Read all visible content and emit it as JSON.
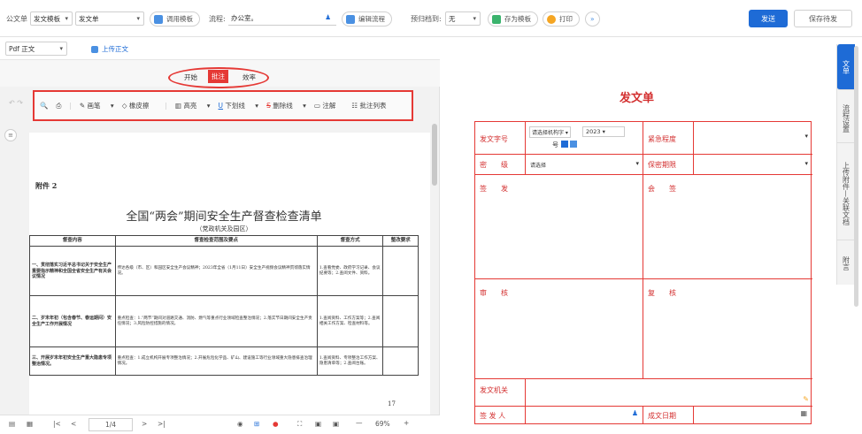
{
  "topbar": {
    "type_label": "公文单",
    "template_value": "发文模板",
    "form_value": "发文单",
    "call_template": "调用模板",
    "flow_label": "流程:",
    "flow_value": "办公室。",
    "edit_flow": "编辑流程",
    "archive_label": "预归档到:",
    "archive_value": "无",
    "save_as_template": "存为模板",
    "print": "打印",
    "send": "发送",
    "save_pending": "保存待发"
  },
  "subbar": {
    "format_value": "Pdf 正文",
    "upload": "上传正文"
  },
  "modes": {
    "start": "开始",
    "annotate": "批注",
    "effect": "效率"
  },
  "toolbar": {
    "brush": "画笔",
    "eraser": "橡皮擦",
    "highlight": "高亮",
    "underline": "下划线",
    "strikethrough": "删除线",
    "note": "注解",
    "list": "批注列表"
  },
  "doc": {
    "attachment": "附件 2",
    "title": "全国“两会”期间安全生产督查检查清单",
    "subtitle": "（党政机关及园区）",
    "headers": [
      "督查内容",
      "督查检查范围及要点",
      "督查方式",
      "整改要求"
    ],
    "rows": [
      {
        "c1": "一、贯彻落实习近平总书记关于安全生产重要指示精神和全国全省安全生产有关会议情况",
        "c2": "传达各级（市、区）和园区安全生产会议精神；2023年全省（1月11日）安全生产视频会议精神贯彻落实情况。",
        "c3": "1.查看党委、政府学习记录、会议纪要等；2.查阅文件、资料。"
      },
      {
        "c1": "二、岁末年初（包含春节、春运期间）安全生产工作开展情况",
        "c2": "重点检查：1.“两节”期间对道路交通、消防、燃气等重点行业领域检查整治情况；2.落实节日期间安全生产责任情况；3.风险防控措施的情况。",
        "c3": "1.查阅资料、工作方案等；2.查阅相关工作方案、检查材料等。"
      },
      {
        "c1": "三、开展岁末年初安全生产重大隐患专项整治情况。",
        "c2": "重点检查：1.成立机构开展专项整治情况；2.开展危险化学品、矿山、建设施工等行业领域重大隐患排查治理情况。",
        "c3": "1.查阅资料、专项整治工作方案、隐患清单等；2.查阅台账。"
      }
    ],
    "page_number": "17"
  },
  "bottombar": {
    "page": "1/4",
    "zoom": "69%"
  },
  "form": {
    "title": "发文单",
    "doc_number": "发文字号",
    "org_select": "请选择机构字",
    "year": "2023",
    "hao": "号",
    "urgency": "紧急程度",
    "secret": "密　　级",
    "secret_select": "请选择",
    "keep_period": "保密期限",
    "signer": "签　　发",
    "cosign": "会　　签",
    "review": "审　　核",
    "recheck": "复　　核",
    "issuer_org": "发文机关",
    "issuer": "签 发 人",
    "date": "成文日期"
  },
  "side_tabs": [
    "文单",
    "流程设置",
    "上传附件—关联文档",
    "附言"
  ],
  "colors": {
    "accent": "#1e6bd6",
    "form_red": "#e53935"
  }
}
